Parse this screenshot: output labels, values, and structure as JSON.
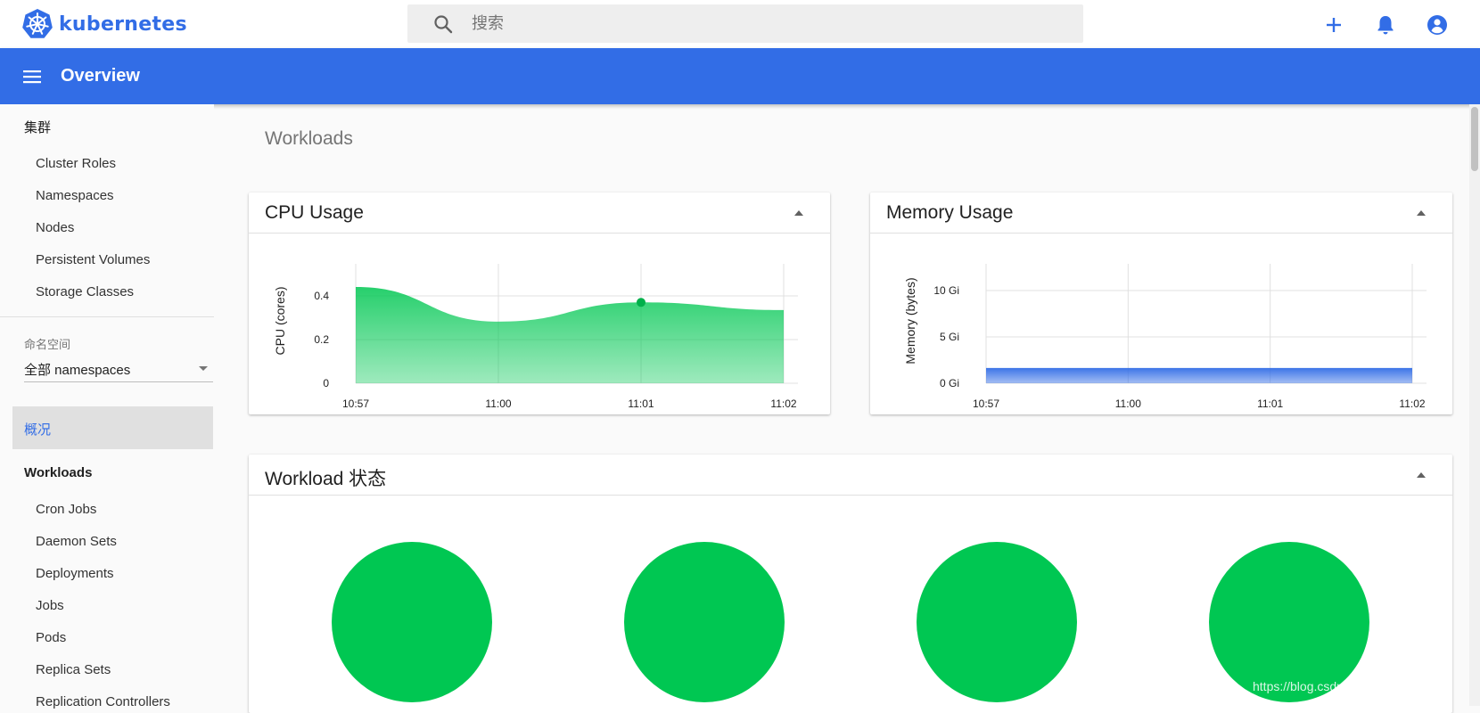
{
  "app": {
    "name": "kubernetes",
    "brand_color": "#326de6"
  },
  "search": {
    "placeholder": "搜索"
  },
  "header": {
    "title": "Overview"
  },
  "sidebar": {
    "cluster_heading": "集群",
    "cluster_items": [
      "Cluster Roles",
      "Namespaces",
      "Nodes",
      "Persistent Volumes",
      "Storage Classes"
    ],
    "namespace_label": "命名空间",
    "namespace_value": "全部 namespaces",
    "active_item": "概况",
    "workloads_heading": "Workloads",
    "workload_items": [
      "Cron Jobs",
      "Daemon Sets",
      "Deployments",
      "Jobs",
      "Pods",
      "Replica Sets",
      "Replication Controllers"
    ]
  },
  "main": {
    "title": "Workloads",
    "status_card_title": "Workload 状态",
    "status_color": "#00c752"
  },
  "chart_data": [
    {
      "type": "area",
      "title": "CPU Usage",
      "ylabel": "CPU (cores)",
      "x": [
        "10:57",
        "11:00",
        "11:01",
        "11:02"
      ],
      "series": [
        {
          "values": [
            0.5,
            0.32,
            0.42,
            0.38
          ]
        }
      ],
      "yticks": [
        "0",
        "0.2",
        "0.4"
      ],
      "ylim": [
        0,
        0.5
      ],
      "color": "#00c752",
      "grid": true
    },
    {
      "type": "area",
      "title": "Memory Usage",
      "ylabel": "Memory (bytes)",
      "x": [
        "10:57",
        "11:00",
        "11:01",
        "11:02"
      ],
      "series": [
        {
          "values": [
            1.9,
            1.9,
            1.9,
            1.9
          ]
        }
      ],
      "yticks": [
        "0 Gi",
        "5 Gi",
        "10 Gi"
      ],
      "ylim": [
        0,
        12
      ],
      "color": "#326de6",
      "grid": true
    }
  ],
  "watermark": "https://blog.csdn.net/qq_37242520"
}
